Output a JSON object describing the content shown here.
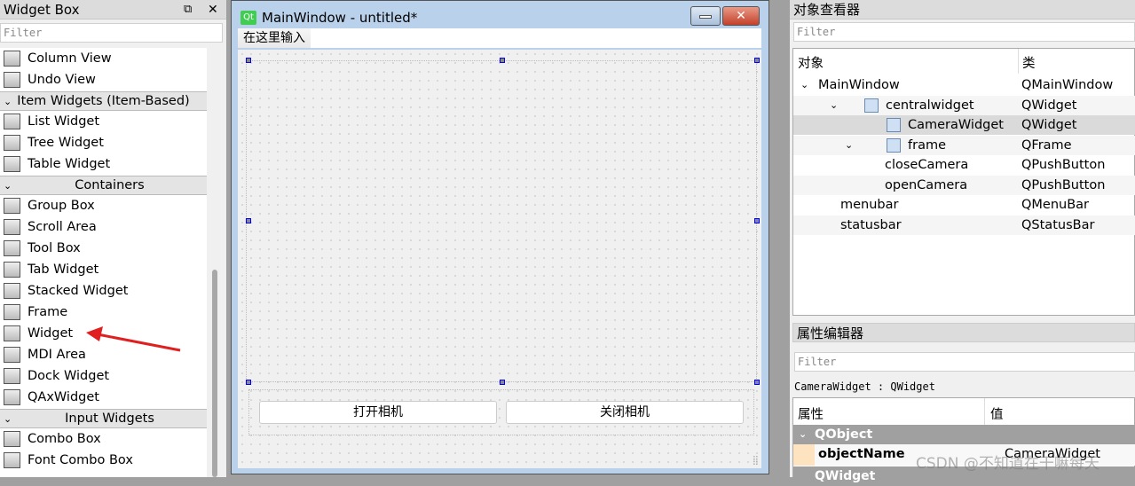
{
  "widget_box": {
    "title": "Widget Box",
    "filter_placeholder": "Filter",
    "items": [
      {
        "type": "item",
        "label": "Column View",
        "icon": "column-view-icon"
      },
      {
        "type": "item",
        "label": "Undo View",
        "icon": "undo-view-icon"
      },
      {
        "type": "cat",
        "label": "Item Widgets (Item-Based)"
      },
      {
        "type": "item",
        "label": "List Widget",
        "icon": "list-widget-icon"
      },
      {
        "type": "item",
        "label": "Tree Widget",
        "icon": "tree-widget-icon"
      },
      {
        "type": "item",
        "label": "Table Widget",
        "icon": "table-widget-icon"
      },
      {
        "type": "cat",
        "label": "Containers"
      },
      {
        "type": "item",
        "label": "Group Box",
        "icon": "group-box-icon"
      },
      {
        "type": "item",
        "label": "Scroll Area",
        "icon": "scroll-area-icon"
      },
      {
        "type": "item",
        "label": "Tool Box",
        "icon": "tool-box-icon"
      },
      {
        "type": "item",
        "label": "Tab Widget",
        "icon": "tab-widget-icon"
      },
      {
        "type": "item",
        "label": "Stacked Widget",
        "icon": "stacked-widget-icon"
      },
      {
        "type": "item",
        "label": "Frame",
        "icon": "frame-icon"
      },
      {
        "type": "item",
        "label": "Widget",
        "icon": "widget-icon"
      },
      {
        "type": "item",
        "label": "MDI Area",
        "icon": "mdi-area-icon"
      },
      {
        "type": "item",
        "label": "Dock Widget",
        "icon": "dock-widget-icon"
      },
      {
        "type": "item",
        "label": "QAxWidget",
        "icon": "qaxwidget-icon"
      },
      {
        "type": "cat",
        "label": "Input Widgets"
      },
      {
        "type": "item",
        "label": "Combo Box",
        "icon": "combo-box-icon"
      },
      {
        "type": "item",
        "label": "Font Combo Box",
        "icon": "font-combo-box-icon"
      }
    ]
  },
  "form": {
    "title": "MainWindow - untitled*",
    "menu_item": "在这里输入",
    "open_button": "打开相机",
    "close_button": "关闭相机"
  },
  "object_inspector": {
    "title": "对象查看器",
    "filter_placeholder": "Filter",
    "col_object": "对象",
    "col_class": "类",
    "rows": [
      {
        "name": "MainWindow",
        "class": "QMainWindow",
        "depth": 0,
        "expanded": true
      },
      {
        "name": "centralwidget",
        "class": "QWidget",
        "depth": 1,
        "expanded": true
      },
      {
        "name": "CameraWidget",
        "class": "QWidget",
        "depth": 2,
        "selected": true
      },
      {
        "name": "frame",
        "class": "QFrame",
        "depth": 2,
        "expanded": true
      },
      {
        "name": "closeCamera",
        "class": "QPushButton",
        "depth": 3
      },
      {
        "name": "openCamera",
        "class": "QPushButton",
        "depth": 3
      },
      {
        "name": "menubar",
        "class": "QMenuBar",
        "depth": 1
      },
      {
        "name": "statusbar",
        "class": "QStatusBar",
        "depth": 1
      }
    ]
  },
  "property_editor": {
    "title": "属性编辑器",
    "filter_placeholder": "Filter",
    "object_label": "CameraWidget : QWidget",
    "col_property": "属性",
    "col_value": "值",
    "group1": "QObject",
    "prop_name": "objectName",
    "prop_value": "CameraWidget",
    "group2": "QWidget"
  },
  "watermark": "CSDN @不知道在干嘛每天"
}
